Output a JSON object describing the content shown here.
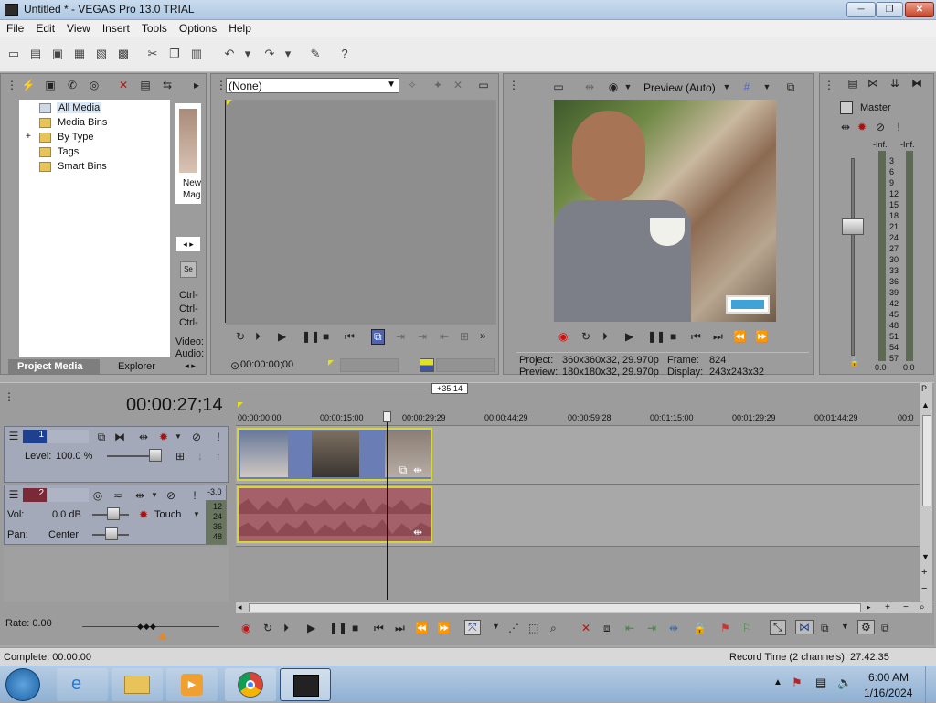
{
  "window": {
    "title": "Untitled * - VEGAS Pro 13.0 TRIAL",
    "minimize": "─",
    "maximize": "❐",
    "close": "✕"
  },
  "menu": [
    "File",
    "Edit",
    "View",
    "Insert",
    "Tools",
    "Options",
    "Help"
  ],
  "project_media": {
    "tree": [
      "All Media",
      "Media Bins",
      "By Type",
      "Tags",
      "Smart Bins"
    ],
    "expand": "+",
    "thumb_text": [
      "New",
      "Mag"
    ],
    "side_texts": [
      "Ctrl-",
      "Ctrl-",
      "Ctrl-",
      "Video:",
      "Audio:"
    ],
    "tabs": [
      "Project Media",
      "Explorer"
    ]
  },
  "trimmer": {
    "dropdown": "(None)",
    "timecode": "00:00:00;00"
  },
  "preview": {
    "quality": "Preview (Auto)",
    "project_label": "Project:",
    "project_value": "360x360x32, 29.970p",
    "preview_label": "Preview:",
    "preview_value": "180x180x32, 29.970p",
    "frame_label": "Frame:",
    "frame_value": "824",
    "display_label": "Display:",
    "display_value": "243x243x32"
  },
  "master": {
    "label": "Master",
    "inf_left": "-Inf.",
    "inf_right": "-Inf.",
    "scale": [
      "3",
      "6",
      "9",
      "12",
      "15",
      "18",
      "21",
      "24",
      "27",
      "30",
      "33",
      "36",
      "39",
      "42",
      "45",
      "48",
      "51",
      "54",
      "57"
    ],
    "bottom_left": "0.0",
    "bottom_right": "0.0"
  },
  "timeline": {
    "timecode": "00:00:27;14",
    "region_len": "+35:14",
    "ruler": [
      "00:00:00;00",
      "00:00:15;00",
      "00:00:29;29",
      "00:00:44;29",
      "00:00:59;28",
      "00:01:15;00",
      "00:01:29;29",
      "00:01:44;29",
      "00:0"
    ],
    "video_track": {
      "number": "1",
      "level_label": "Level:",
      "level_value": "100.0 %"
    },
    "audio_track": {
      "number": "2",
      "vol_label": "Vol:",
      "vol_value": "0.0 dB",
      "pan_label": "Pan:",
      "pan_value": "Center",
      "mode": "Touch",
      "meter_top": "-3.0",
      "meter_scale": [
        "12",
        "24",
        "36",
        "48"
      ]
    },
    "rate": "Rate: 0.00"
  },
  "status": {
    "left": "Complete: 00:00:00",
    "right": "Record Time (2 channels): 27:42:35"
  },
  "taskbar": {
    "time": "6:00 AM",
    "date": "1/16/2024"
  },
  "colors": {
    "accent": "#1f3f8f",
    "clip_border": "#d6d63a",
    "audio_wave": "#8d4a52",
    "panel": "#9c9c9c"
  }
}
